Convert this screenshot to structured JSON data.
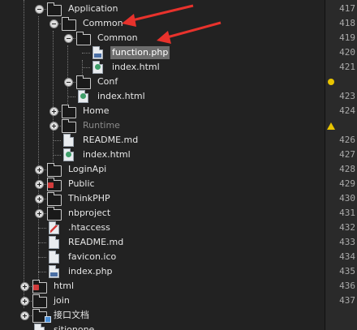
{
  "tree": {
    "rows": [
      {
        "label": "Application",
        "icon": "folder-icon",
        "level": 1,
        "toggle": "expanded",
        "dim": false,
        "selected": false
      },
      {
        "label": "Common",
        "icon": "folder-icon",
        "level": 2,
        "toggle": "expanded",
        "dim": false,
        "selected": false
      },
      {
        "label": "Common",
        "icon": "folder-icon",
        "level": 3,
        "toggle": "expanded",
        "dim": false,
        "selected": false
      },
      {
        "label": "function.php",
        "icon": "php-file-icon",
        "level": 4,
        "toggle": "none",
        "dim": false,
        "selected": true
      },
      {
        "label": "index.html",
        "icon": "html-file-icon",
        "level": 4,
        "toggle": "none",
        "dim": false,
        "selected": false
      },
      {
        "label": "Conf",
        "icon": "folder-icon",
        "level": 3,
        "toggle": "expanded",
        "dim": false,
        "selected": false
      },
      {
        "label": "index.html",
        "icon": "html-file-icon",
        "level": 3,
        "toggle": "none",
        "dim": false,
        "selected": false
      },
      {
        "label": "Home",
        "icon": "folder-icon",
        "level": 2,
        "toggle": "collapsed",
        "dim": false,
        "selected": false
      },
      {
        "label": "Runtime",
        "icon": "folder-icon",
        "level": 2,
        "toggle": "collapsed",
        "dim": true,
        "selected": false
      },
      {
        "label": "README.md",
        "icon": "file-icon",
        "level": 2,
        "toggle": "none",
        "dim": false,
        "selected": false
      },
      {
        "label": "index.html",
        "icon": "html-file-icon",
        "level": 2,
        "toggle": "none",
        "dim": false,
        "selected": false
      },
      {
        "label": "LoginApi",
        "icon": "folder-icon",
        "level": 1,
        "toggle": "collapsed",
        "dim": false,
        "selected": false
      },
      {
        "label": "Public",
        "icon": "folder-badge-icon",
        "level": 1,
        "toggle": "collapsed",
        "dim": false,
        "selected": false
      },
      {
        "label": "ThinkPHP",
        "icon": "folder-icon",
        "level": 1,
        "toggle": "collapsed",
        "dim": false,
        "selected": false
      },
      {
        "label": "nbproject",
        "icon": "folder-icon",
        "level": 1,
        "toggle": "collapsed",
        "dim": false,
        "selected": false
      },
      {
        "label": ".htaccess",
        "icon": "htaccess-file-icon",
        "level": 1,
        "toggle": "none",
        "dim": false,
        "selected": false
      },
      {
        "label": "README.md",
        "icon": "file-icon",
        "level": 1,
        "toggle": "none",
        "dim": false,
        "selected": false
      },
      {
        "label": "favicon.ico",
        "icon": "file-icon",
        "level": 1,
        "toggle": "none",
        "dim": false,
        "selected": false
      },
      {
        "label": "index.php",
        "icon": "php-file-icon",
        "level": 1,
        "toggle": "none",
        "dim": false,
        "selected": false
      },
      {
        "label": "html",
        "icon": "folder-badge-icon",
        "level": 0,
        "toggle": "collapsed",
        "dim": false,
        "selected": false
      },
      {
        "label": "join",
        "icon": "folder-icon",
        "level": 0,
        "toggle": "collapsed",
        "dim": false,
        "selected": false
      },
      {
        "label": "接口文档",
        "icon": "folder-subfolder-icon",
        "level": 0,
        "toggle": "collapsed",
        "dim": false,
        "selected": false
      },
      {
        "label": "sitionone",
        "icon": "file-icon",
        "level": 0,
        "toggle": "none",
        "dim": false,
        "selected": false
      }
    ]
  },
  "gutter": {
    "lines": [
      "417",
      "418",
      "419",
      "420",
      "421",
      "",
      "423",
      "424",
      "",
      "426",
      "427",
      "428",
      "429",
      "430",
      "431",
      "432",
      "433",
      "434",
      "435",
      "436",
      "437"
    ],
    "markers": [
      {
        "row": 5,
        "type": "bulb-icon"
      },
      {
        "row": 8,
        "type": "warning-icon"
      }
    ]
  },
  "colors": {
    "arrow": "#e8322c",
    "selection": "#6d6d6d"
  }
}
